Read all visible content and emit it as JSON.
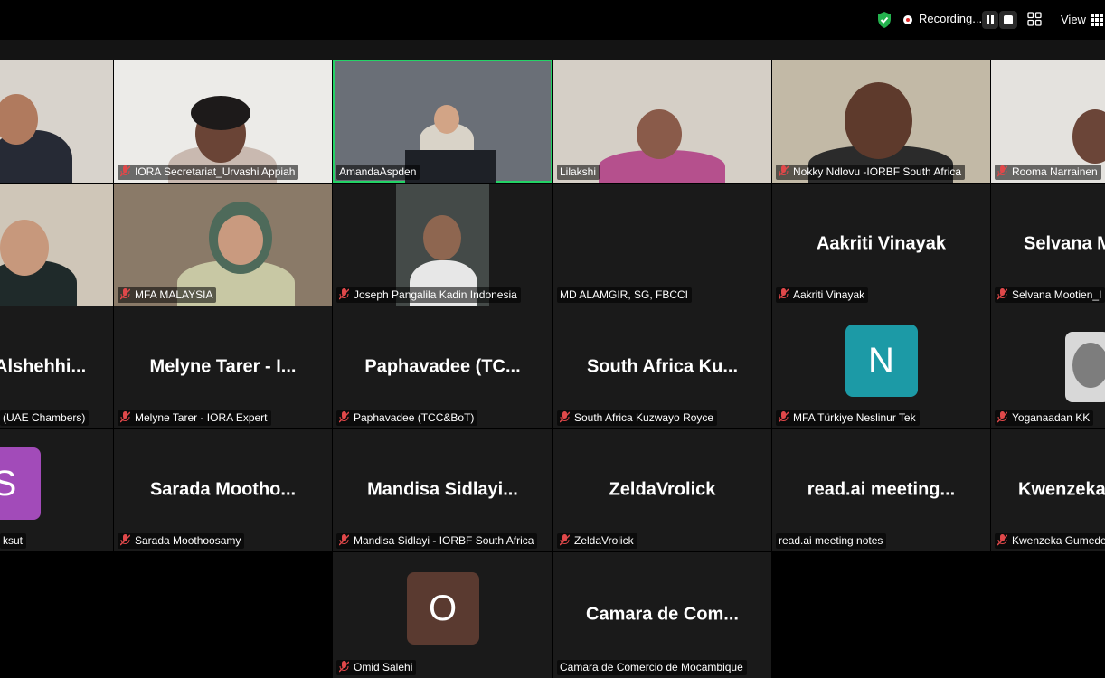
{
  "toolbar": {
    "recording_label": "Recording...",
    "view_label": "View",
    "icons": [
      "shield-check-icon",
      "record-dot-icon",
      "pause-icon",
      "stop-icon",
      "apps-grid-icon",
      "gallery-view-icon"
    ]
  },
  "colors": {
    "active_speaker_border": "#23d366",
    "muted_mic": "#e0484a",
    "avatar_N": "#1c9aa6",
    "avatar_S": "#a24bb9",
    "avatar_O": "#5a3a30"
  },
  "participants": [
    {
      "label": ""
    },
    {
      "label": "IORA Secretariat_Urvashi Appiah"
    },
    {
      "label": "AmandaAspden"
    },
    {
      "label": "Lilakshi"
    },
    {
      "label": "Nokky Ndlovu -IORBF South Africa"
    },
    {
      "label": "Rooma Narrainen"
    },
    {
      "label": ""
    },
    {
      "label": "MFA MALAYSIA"
    },
    {
      "label": "Joseph Pangalila Kadin Indonesia"
    },
    {
      "label": "MD ALAMGIR, SG, FBCCI"
    },
    {
      "label": "Aakriti Vinayak",
      "display": "Aakriti Vinayak"
    },
    {
      "label": "Selvana Mootien_I",
      "display": "Selvana M"
    },
    {
      "label": "(UAE Chambers)",
      "display": "Alshehhi..."
    },
    {
      "label": "Melyne Tarer - IORA Expert",
      "display": "Melyne Tarer - I..."
    },
    {
      "label": "Paphavadee (TCC&BoT)",
      "display": "Paphavadee (TC..."
    },
    {
      "label": "South Africa Kuzwayo Royce",
      "display": "South Africa Ku..."
    },
    {
      "label": "MFA Türkiye Neslinur Tek",
      "avatar": "N"
    },
    {
      "label": "Yoganaadan KK"
    },
    {
      "label": "ksut",
      "avatar": "S"
    },
    {
      "label": "Sarada Moothoosamy",
      "display": "Sarada Mootho..."
    },
    {
      "label": "Mandisa Sidlayi - IORBF South Africa",
      "display": "Mandisa Sidlayi..."
    },
    {
      "label": "ZeldaVrolick",
      "display": "ZeldaVrolick"
    },
    {
      "label": "read.ai meeting notes",
      "display": "read.ai meeting..."
    },
    {
      "label": "Kwenzeka Gumede",
      "display": "Kwenzeka"
    },
    {
      "label": "Omid Salehi",
      "avatar": "O"
    },
    {
      "label": "Camara de Comercio de Mocambique",
      "display": "Camara de Com..."
    }
  ]
}
